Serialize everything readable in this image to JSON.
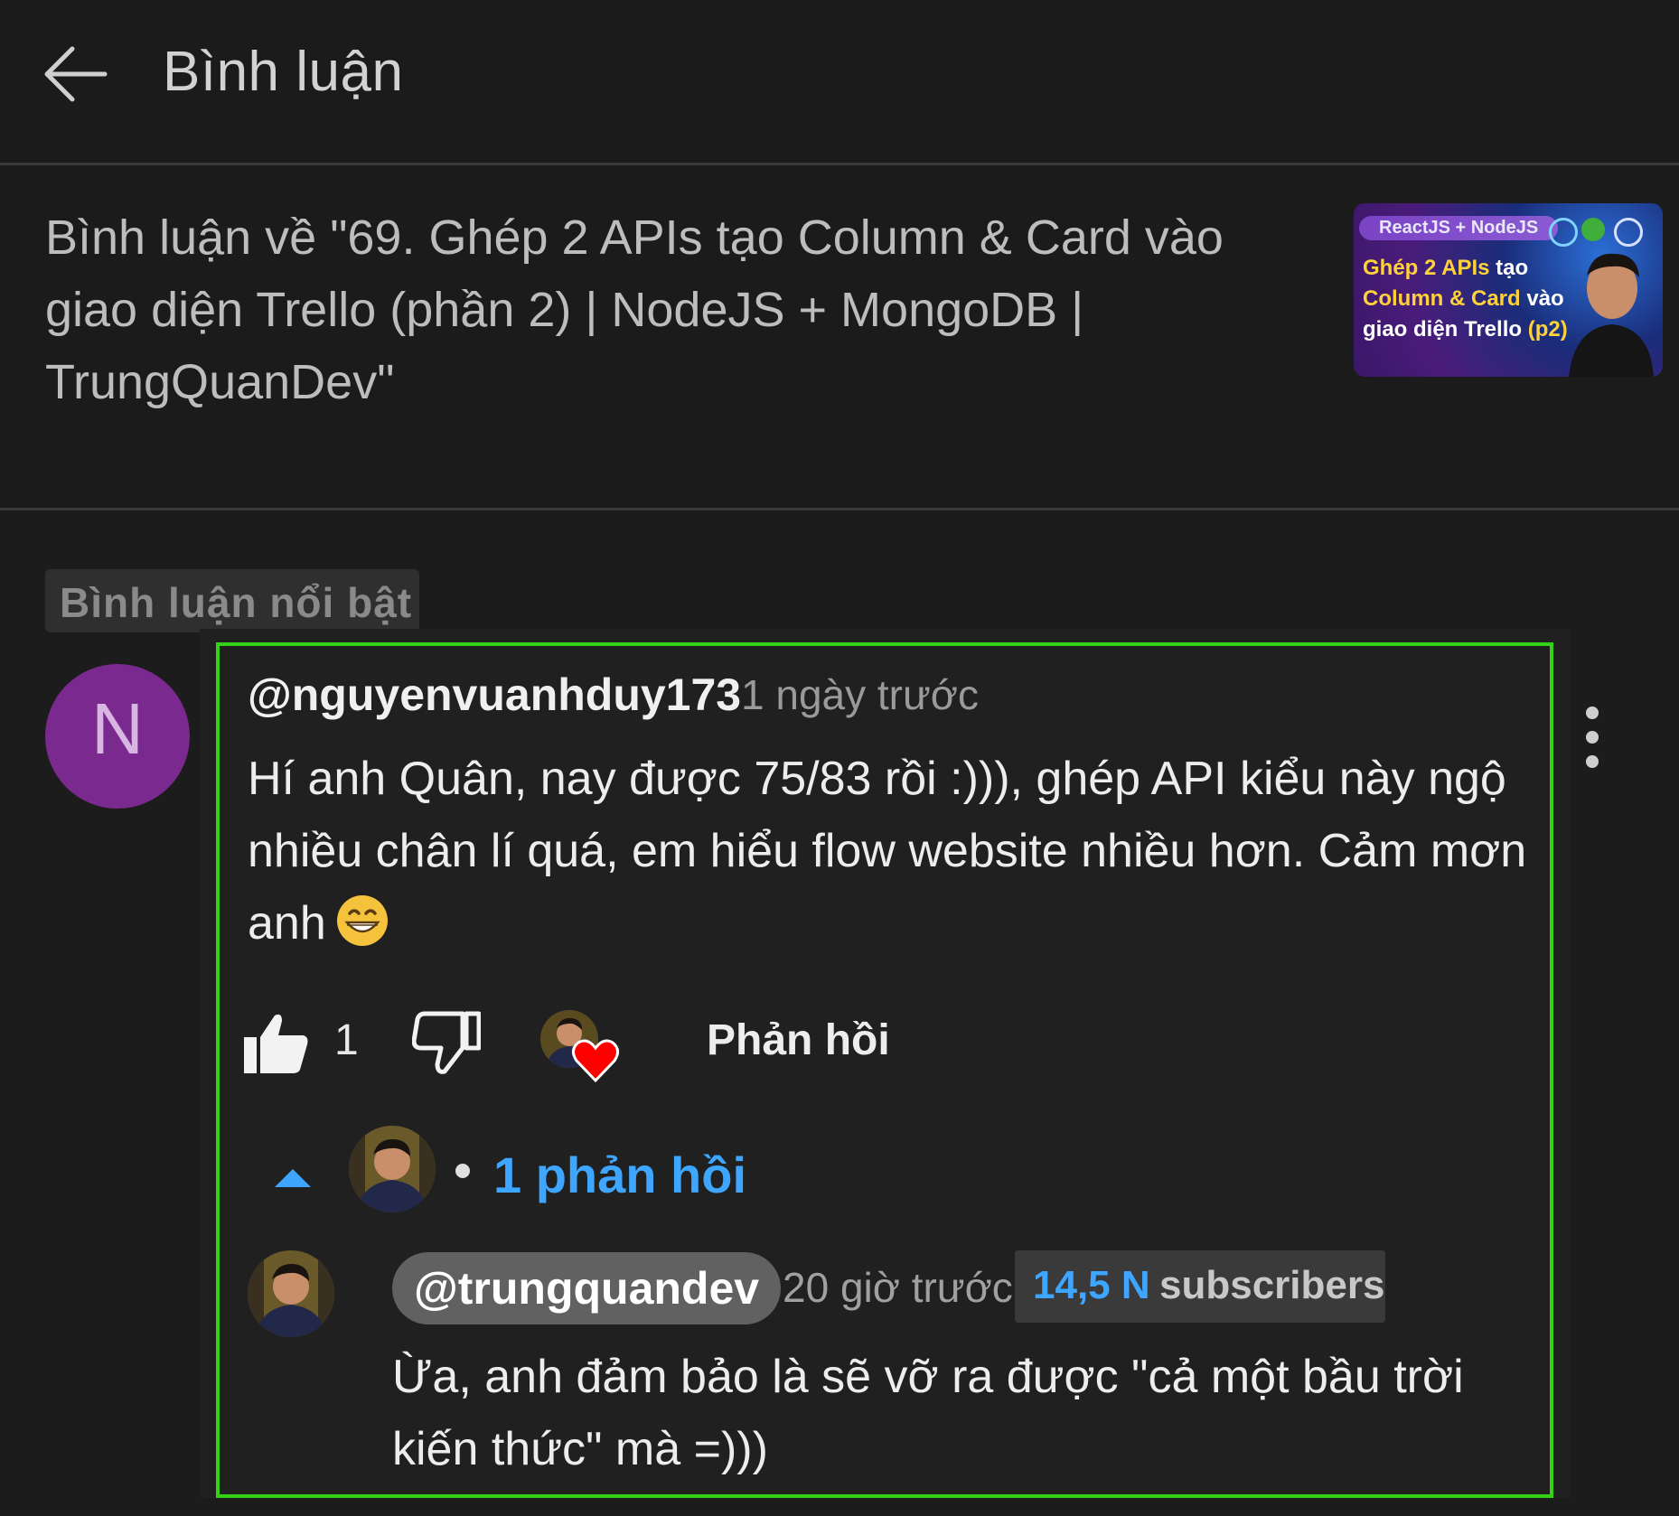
{
  "header": {
    "title": "Bình luận"
  },
  "video": {
    "description": "Bình luận về \"69. Ghép 2 APIs tạo Column & Card vào giao diện Trello (phần 2) | NodeJS + MongoDB | TrungQuanDev\"",
    "thumbnail": {
      "tag": "ReactJS + NodeJS",
      "line1_highlight": "Ghép 2 APIs",
      "line1_rest": " tạo",
      "line2_highlight": "Column & Card",
      "line2_rest": " vào",
      "line3_white": "giao diện Trello ",
      "line3_highlight": "(p2)"
    }
  },
  "section": {
    "featured_label": "Bình luận nổi bật"
  },
  "comment": {
    "avatar_letter": "N",
    "author": "@nguyenvuanhduy173",
    "time": "1 ngày trước",
    "text": "Hí anh Quân, nay được 75/83 rồi :))), ghép API kiểu này ngộ nhiều chân lí quá, em hiểu flow website nhiều hơn. Cảm mơn anh",
    "emoji": "grinning-face-with-smiling-eyes",
    "like_count": "1",
    "reply_label": "Phản hồi",
    "replies_label": "1 phản hồi"
  },
  "reply": {
    "author": "@trungquandev",
    "time": "20 giờ trước",
    "subscribers_count": "14,5 N",
    "subscribers_label": "subscribers",
    "text": "Ừa, anh đảm bảo là sẽ vỡ ra được \"cả một bầu trời kiến thức\" mà =)))"
  },
  "colors": {
    "background": "#1c1c1c",
    "link_blue": "#3ea6ff",
    "highlight_border": "#34d116",
    "avatar_purple": "#7a2a8e",
    "heart_red": "#ff0000"
  },
  "icons": [
    "back-arrow-icon",
    "more-vert-icon",
    "thumb-up-icon",
    "thumb-down-icon",
    "heart-icon",
    "chevron-up-icon"
  ]
}
